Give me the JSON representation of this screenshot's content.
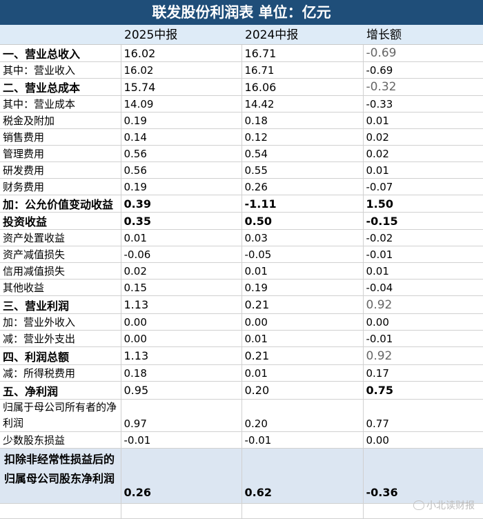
{
  "title": "联发股份利润表 单位：亿元",
  "columns": [
    "2025中报",
    "2024中报",
    "增长额"
  ],
  "rows": [
    {
      "label": "一、营业总收入",
      "v2025": "16.02",
      "v2024": "16.71",
      "diff": "-0.69"
    },
    {
      "label": "其中：营业收入",
      "v2025": "16.02",
      "v2024": "16.71",
      "diff": "-0.69"
    },
    {
      "label": "二、营业总成本",
      "v2025": "15.74",
      "v2024": "16.06",
      "diff": "-0.32"
    },
    {
      "label": "其中：营业成本",
      "v2025": "14.09",
      "v2024": "14.42",
      "diff": "-0.33"
    },
    {
      "label": "税金及附加",
      "v2025": "0.19",
      "v2024": "0.18",
      "diff": "0.01"
    },
    {
      "label": "销售费用",
      "v2025": "0.14",
      "v2024": "0.12",
      "diff": "0.02"
    },
    {
      "label": "管理费用",
      "v2025": "0.56",
      "v2024": "0.54",
      "diff": "0.02"
    },
    {
      "label": "研发费用",
      "v2025": "0.56",
      "v2024": "0.55",
      "diff": "0.01"
    },
    {
      "label": "财务费用",
      "v2025": "0.19",
      "v2024": "0.26",
      "diff": "-0.07"
    },
    {
      "label": "加：公允价值变动收益",
      "v2025": "0.39",
      "v2024": "-1.11",
      "diff": "1.50"
    },
    {
      "label": "投资收益",
      "v2025": "0.35",
      "v2024": "0.50",
      "diff": "-0.15"
    },
    {
      "label": "资产处置收益",
      "v2025": "0.01",
      "v2024": "0.03",
      "diff": "-0.02"
    },
    {
      "label": "资产减值损失",
      "v2025": "-0.06",
      "v2024": "-0.05",
      "diff": "-0.01"
    },
    {
      "label": "信用减值损失",
      "v2025": "0.02",
      "v2024": "0.01",
      "diff": "0.01"
    },
    {
      "label": "其他收益",
      "v2025": "0.15",
      "v2024": "0.19",
      "diff": "-0.04"
    },
    {
      "label": "三、营业利润",
      "v2025": "1.13",
      "v2024": "0.21",
      "diff": "0.92"
    },
    {
      "label": "加：营业外收入",
      "v2025": "0.00",
      "v2024": "0.00",
      "diff": "0.00"
    },
    {
      "label": "减：营业外支出",
      "v2025": "0.00",
      "v2024": "0.01",
      "diff": "-0.01"
    },
    {
      "label": "四、利润总额",
      "v2025": "1.13",
      "v2024": "0.21",
      "diff": "0.92"
    },
    {
      "label": "减：所得税费用",
      "v2025": "0.18",
      "v2024": "0.01",
      "diff": "0.17"
    },
    {
      "label": "五、净利润",
      "v2025": "0.95",
      "v2024": "0.20",
      "diff": "0.75"
    },
    {
      "label": "归属于母公司所有者的净利润",
      "v2025": "0.97",
      "v2024": "0.20",
      "diff": "0.77"
    },
    {
      "label": "少数股东损益",
      "v2025": "-0.01",
      "v2024": "-0.01",
      "diff": "0.00"
    },
    {
      "label": "扣除非经常性损益后的归属母公司股东净利润",
      "v2025": "0.26",
      "v2024": "0.62",
      "diff": "-0.36"
    }
  ],
  "watermark": "小北读财报"
}
